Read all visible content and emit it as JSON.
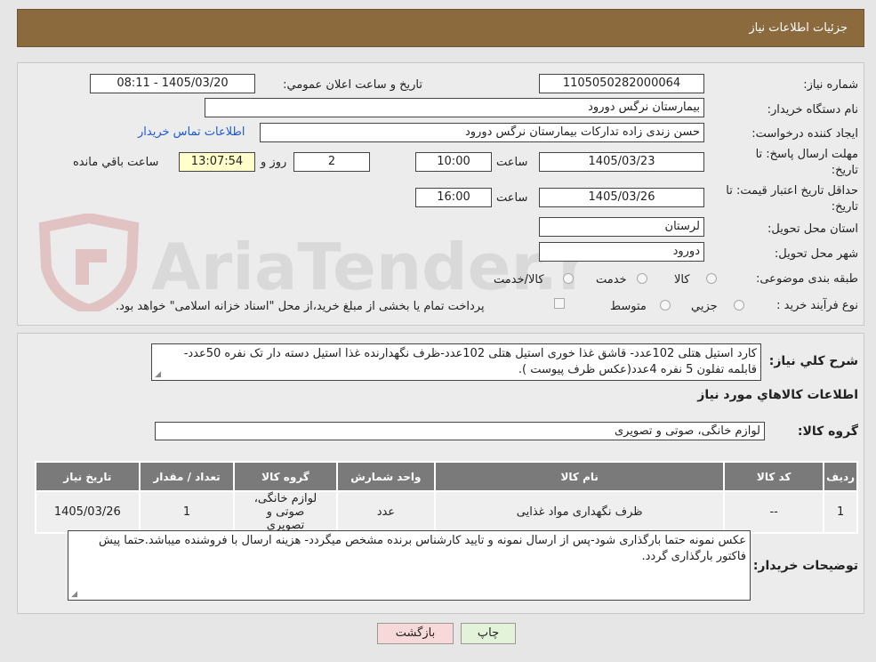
{
  "header": {
    "title": "جزئیات اطلاعات نیاز"
  },
  "form": {
    "need_number_label": "شماره نیاز:",
    "need_number": "1105050282000064",
    "announce_label": "تاریخ و ساعت اعلان عمومي:",
    "announce_value": "1405/03/20 - 08:11",
    "buyer_org_label": "نام دستگاه خریدار:",
    "buyer_org": "بیمارستان نرگس دورود",
    "creator_label": "ایجاد کننده درخواست:",
    "creator": "حسن  زندی زاده  تدارکات بیمارستان نرگس دورود",
    "contact_link": "اطلاعات تماس خریدار",
    "deadline_label_1": "مهلت ارسال پاسخ: تا",
    "deadline_label_2": "تاریخ:",
    "deadline_date": "1405/03/23",
    "time_label": "ساعت",
    "deadline_time": "10:00",
    "days_value": "2",
    "days_label": "روز و",
    "remaining_time": "13:07:54",
    "remaining_label": "ساعت باقي مانده",
    "validity_label_1": "حداقل تاریخ اعتبار قیمت: تا",
    "validity_label_2": "تاریخ:",
    "validity_date": "1405/03/26",
    "validity_time": "16:00",
    "province_label": "استان محل تحویل:",
    "province": "لرستان",
    "city_label": "شهر محل تحویل:",
    "city": "دورود",
    "category_label": "طبقه بندی موضوعی:",
    "category_options": [
      "کالا",
      "خدمت",
      "کالا/خدمت"
    ],
    "process_label": "نوع فرآیند خرید :",
    "process_options": [
      "جزيي",
      "متوسط"
    ],
    "payment_note": "پرداخت تمام یا بخشی از مبلغ خرید،از محل \"اسناد خزانه اسلامی\" خواهد بود."
  },
  "watermark": {
    "text": "AriaTender.neT"
  },
  "description": {
    "label": "شرح کلي نیاز:",
    "text": "کارد استیل هتلی 102عدد- قاشق غذا خوری استیل هتلی 102عدد-ظرف نگهدارنده غذا استیل  دسته دار تک نفره 50عدد- قابلمه تفلون 5 نفره 4عدد(عکس ظرف پیوست )."
  },
  "goods": {
    "section_title": "اطلاعات کالاهاي مورد نیاز",
    "group_label": "گروه کالا:",
    "group_value": "لوازم خانگی، صوتی و تصویری",
    "columns": [
      "ردیف",
      "کد کالا",
      "نام کالا",
      "واحد شمارش",
      "گروه کالا",
      "تعداد / مقدار",
      "تاریخ نیاز"
    ],
    "rows": [
      [
        "1",
        "--",
        "ظرف نگهداری مواد غذایی",
        "عدد",
        "لوازم خانگی، صوتی و تصویری",
        "1",
        "1405/03/26"
      ]
    ]
  },
  "buyer_notes": {
    "label": "توضیحات خریدار:",
    "text": "عکس نمونه حتما بارگذاری شود-پس از ارسال نمونه و تایید کارشناس برنده مشخص میگردد- هزینه ارسال با فروشنده میباشد.حتما پیش فاکتور بارگذاری گردد."
  },
  "buttons": {
    "print": "چاپ",
    "back": "بازگشت"
  },
  "colors": {
    "header_bg": "#8b6a3e",
    "link": "#1a5ad6",
    "table_header": "#7a7a7a",
    "timer_bg": "#ffffcc",
    "back_button_bg": "#f8d9d9",
    "print_button_bg": "#e3f3d9"
  }
}
